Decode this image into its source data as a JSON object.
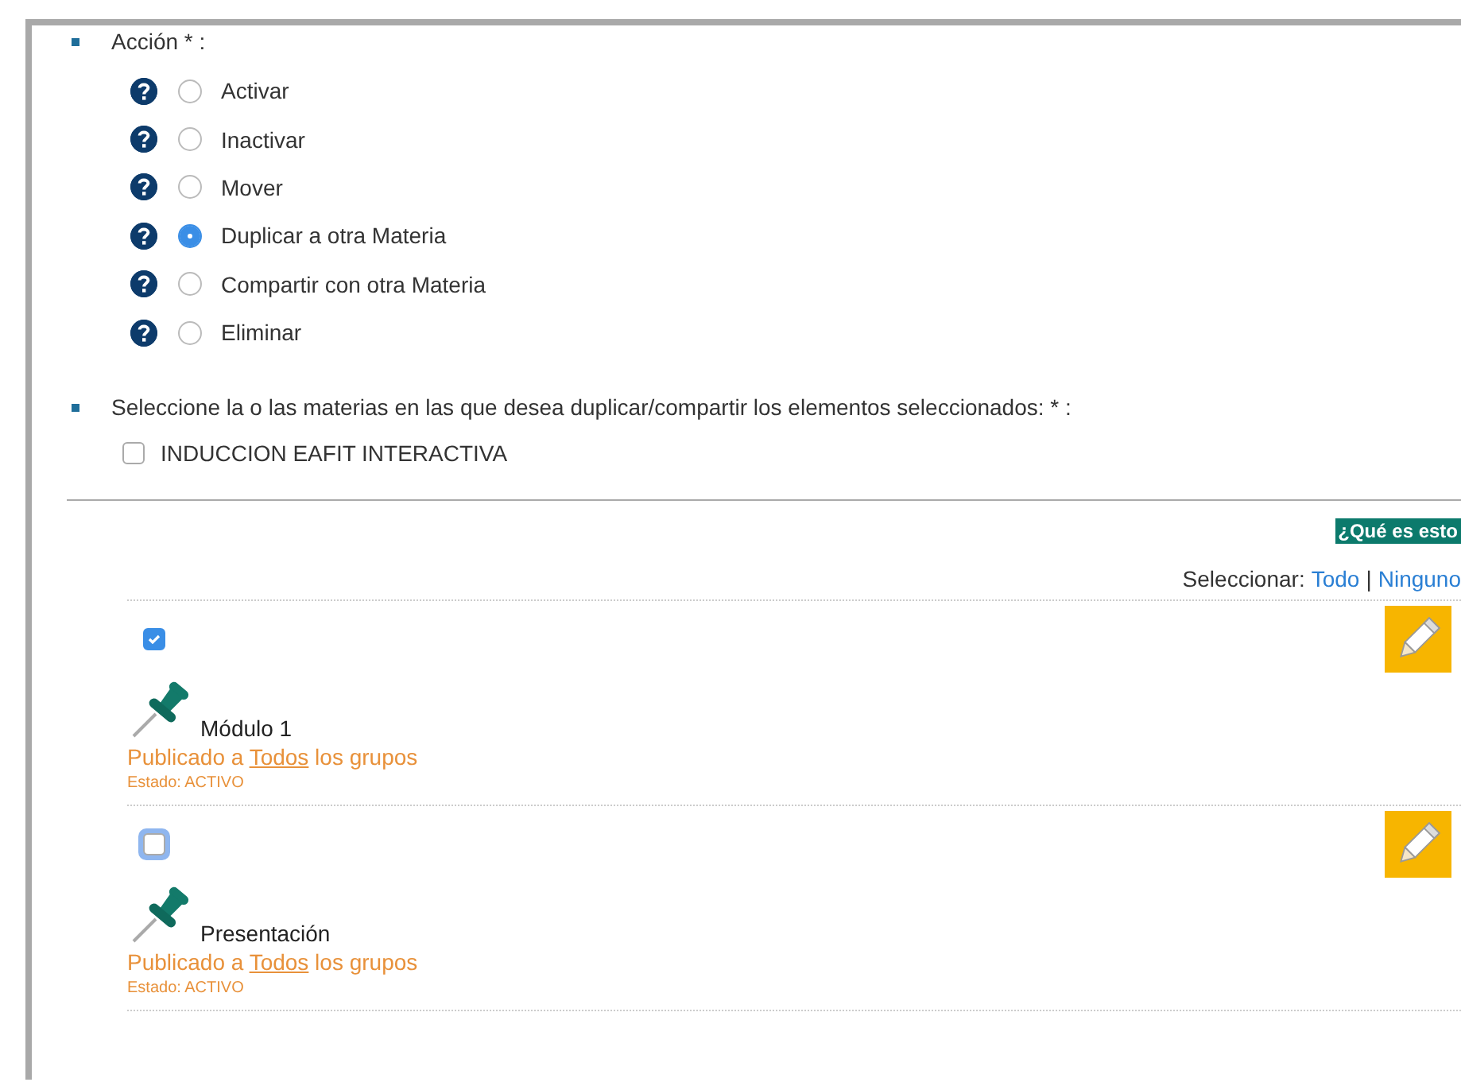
{
  "action": {
    "label": "Acción * :",
    "options": [
      {
        "label": "Activar",
        "selected": false
      },
      {
        "label": "Inactivar",
        "selected": false
      },
      {
        "label": "Mover",
        "selected": false
      },
      {
        "label": "Duplicar a otra Materia",
        "selected": true
      },
      {
        "label": "Compartir con otra Materia",
        "selected": false
      },
      {
        "label": "Eliminar",
        "selected": false
      }
    ]
  },
  "subjects": {
    "label": "Seleccione la o las materias en las que desea duplicar/compartir los elementos seleccionados: * :",
    "options": [
      {
        "label": "INDUCCION EAFIT INTERACTIVA",
        "checked": false
      }
    ]
  },
  "help_badge": "¿Qué es esto",
  "select_bar": {
    "label": "Seleccionar:",
    "all": "Todo",
    "separator": "|",
    "none": "Ninguno"
  },
  "items": [
    {
      "checked": true,
      "focused": false,
      "title": "Módulo 1",
      "published_before": "Publicado a",
      "published_link": "Todos",
      "published_after": "los grupos",
      "status": "Estado: ACTIVO"
    },
    {
      "checked": false,
      "focused": true,
      "title": "Presentación",
      "published_before": "Publicado a",
      "published_link": "Todos",
      "published_after": "los grupos",
      "status": "Estado: ACTIVO"
    }
  ]
}
